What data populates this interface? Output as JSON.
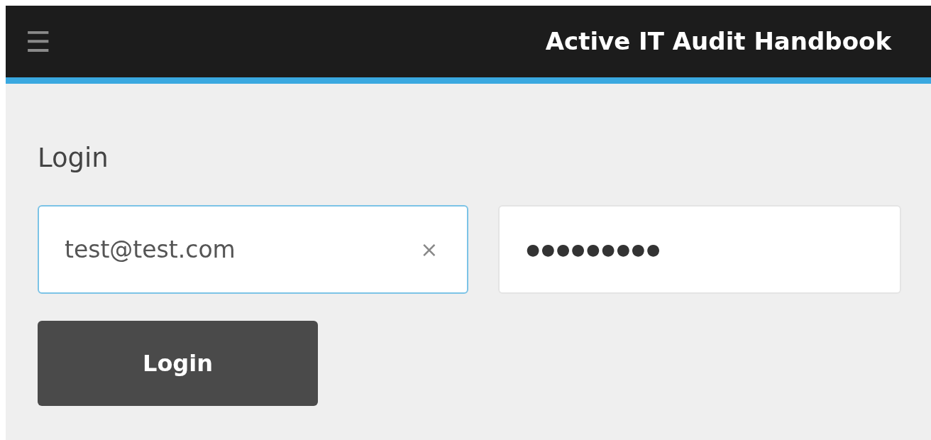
{
  "header": {
    "menu_icon": "☰",
    "title": "Active IT Audit Handbook"
  },
  "form": {
    "heading": "Login",
    "email": {
      "value": "test@test.com",
      "focused": true,
      "clear": "×"
    },
    "password": {
      "value": "●●●●●●●●●",
      "focused": false
    },
    "button": "Login"
  }
}
